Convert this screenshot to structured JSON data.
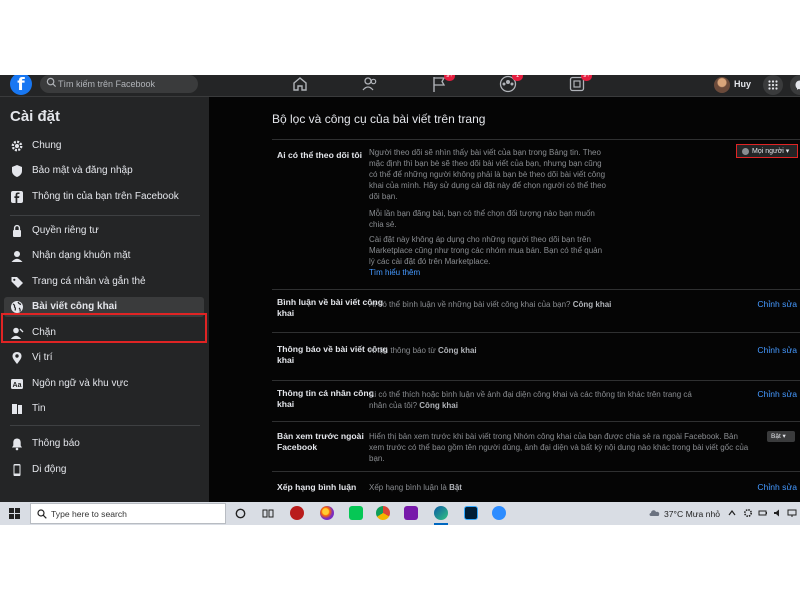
{
  "topbar": {
    "logo": "f",
    "search_placeholder": "Tìm kiếm trên Facebook",
    "badges": {
      "pages": "9+",
      "groups": "1",
      "gaming": "9+"
    },
    "user_name": "Huy"
  },
  "sidebar": {
    "title": "Cài đặt",
    "items": [
      {
        "label": "Chung",
        "icon": "gear-icon"
      },
      {
        "label": "Bảo mật và đăng nhập",
        "icon": "shield-icon"
      },
      {
        "label": "Thông tin của bạn trên Facebook",
        "icon": "facebook-icon"
      },
      {
        "label": "Quyền riêng tư",
        "icon": "lock-icon"
      },
      {
        "label": "Nhận dạng khuôn mặt",
        "icon": "face-icon"
      },
      {
        "label": "Trang cá nhân và gắn thẻ",
        "icon": "tag-icon"
      },
      {
        "label": "Bài viết công khai",
        "icon": "globe-icon"
      },
      {
        "label": "Chặn",
        "icon": "block-user-icon"
      },
      {
        "label": "Vị trí",
        "icon": "location-pin-icon"
      },
      {
        "label": "Ngôn ngữ và khu vực",
        "icon": "language-icon"
      },
      {
        "label": "Tin",
        "icon": "book-icon"
      },
      {
        "label": "Thông báo",
        "icon": "bell-icon"
      },
      {
        "label": "Di động",
        "icon": "mobile-icon"
      }
    ]
  },
  "main": {
    "title": "Bộ lọc và công cụ của bài viết trên trang",
    "rows": [
      {
        "label": "Ai có thể theo dõi tôi",
        "desc_lines": [
          "Người theo dõi sẽ nhìn thấy bài viết của bạn trong Bảng tin. Theo",
          "mặc định thì bạn bè sẽ theo dõi bài viết của bạn, nhưng bạn cũng",
          "có thể để những người không phải là bạn bè theo dõi bài viết công",
          "khai của mình. Hãy sử dụng cài đặt này để chọn người có thể theo",
          "dõi bạn."
        ],
        "desc2_lines": [
          "Mỗi lần bạn đăng bài, bạn có thể chọn đối tượng nào bạn muốn",
          "chia sẻ."
        ],
        "desc3_lines": [
          "Cài đặt này không áp dụng cho những người theo dõi bạn trên",
          "Marketplace cũng như trong các nhóm mua bán. Bạn có thể quản",
          "lý các cài đặt đó trên Marketplace."
        ],
        "link": "Tìm hiểu thêm",
        "audience": "Mọi người ▾"
      },
      {
        "label": "Bình luận về bài viết công khai",
        "desc": "Ai có thể bình luận về những bài viết công khai của bạn?",
        "value": "Công khai",
        "action": "Chỉnh sửa"
      },
      {
        "label": "Thông báo về bài viết công khai",
        "desc": "Nhận thông báo từ",
        "value": "Công khai",
        "action": "Chỉnh sửa"
      },
      {
        "label": "Thông tin cá nhân công khai",
        "desc_lines": [
          "Ai có thể thích hoặc bình luận về ảnh đại diện công khai và các thông tin khác trên trang cá",
          "nhân của tôi?"
        ],
        "value": "Công khai",
        "action": "Chỉnh sửa"
      },
      {
        "label": "Bản xem trước ngoài Facebook",
        "desc_lines": [
          "Hiển thị bản xem trước khi bài viết trong Nhóm công khai của bạn được chia sẻ ra ngoài Facebook. Bản",
          "xem trước có thể bao gồm tên người dùng, ảnh đại diện và bất kỳ nội dung nào khác trong bài viết gốc của",
          "bạn."
        ],
        "toggle": "Bật ▾"
      },
      {
        "label": "Xếp hạng bình luận",
        "desc": "Xếp hạng bình luận là",
        "value": "Bật",
        "action": "Chỉnh sửa"
      }
    ]
  },
  "taskbar": {
    "search_placeholder": "Type here to search",
    "weather": "37°C  Mưa nhỏ"
  },
  "colors": {
    "accent": "#4599ff",
    "highlight_box": "#e02424",
    "facebook_blue": "#1877f2"
  }
}
